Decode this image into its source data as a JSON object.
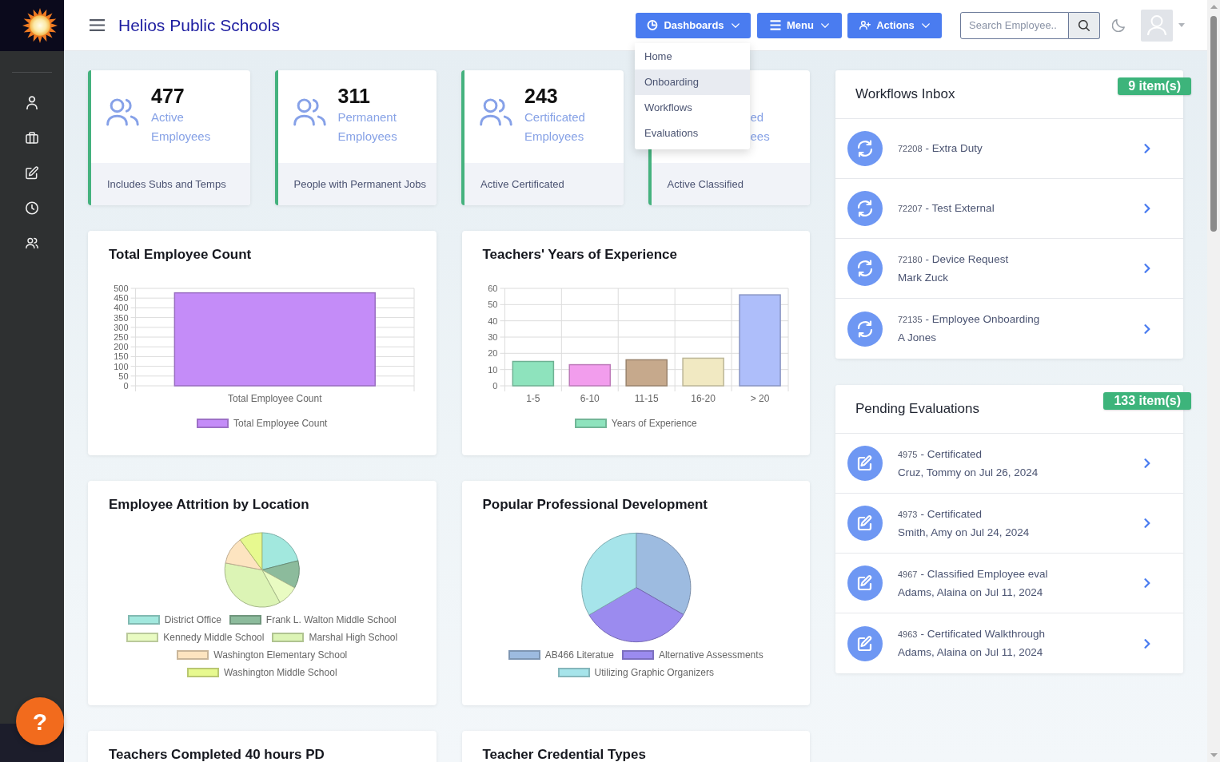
{
  "header": {
    "title": "Helios Public Schools",
    "buttons": [
      {
        "label": "Dashboards"
      },
      {
        "label": "Menu"
      },
      {
        "label": "Actions"
      }
    ],
    "search": {
      "placeholder": "Search Employee.."
    }
  },
  "dashboards_menu": {
    "items": [
      {
        "label": "Home",
        "selected": false
      },
      {
        "label": "Onboarding",
        "selected": true
      },
      {
        "label": "Workflows",
        "selected": false
      },
      {
        "label": "Evaluations",
        "selected": false
      }
    ]
  },
  "stat_cards": [
    {
      "value": "477",
      "label_lines": [
        "Active",
        "Employees"
      ],
      "footer": "Includes Subs and Temps"
    },
    {
      "value": "311",
      "label_lines": [
        "Permanent",
        "Employees"
      ],
      "footer": "People with Permanent Jobs"
    },
    {
      "value": "243",
      "label_lines": [
        "Certificated",
        "Employees"
      ],
      "footer": "Active Certificated"
    },
    {
      "label_lines": [
        "ed",
        "ees"
      ],
      "footer": "Active Classified"
    }
  ],
  "chart_cards": [
    {
      "title": "Total Employee Count",
      "chart_data": {
        "type": "bar",
        "categories": [
          "Total Employee Count"
        ],
        "series": [
          {
            "name": "Total Employee Count",
            "color": "#c48cf8",
            "values": [
              477
            ]
          }
        ],
        "ylim": [
          0,
          500
        ],
        "yticks": [
          0,
          50,
          100,
          150,
          200,
          250,
          300,
          350,
          400,
          450,
          500
        ],
        "grid": true,
        "legend": "bottom"
      }
    },
    {
      "title": "Teachers' Years of Experience",
      "chart_data": {
        "type": "bar",
        "categories": [
          "1-5",
          "6-10",
          "11-15",
          "16-20",
          "> 20"
        ],
        "series": [
          {
            "name": "Years of Experience",
            "color": "#8ee3bd",
            "colors": [
              "#8ee3bd",
              "#f29ded",
              "#c6a98c",
              "#f1e9c2",
              "#aebefa"
            ],
            "values": [
              15,
              13,
              16,
              17,
              56
            ]
          }
        ],
        "ylim": [
          0,
          60
        ],
        "yticks": [
          0,
          10,
          20,
          30,
          40,
          50,
          60
        ],
        "grid": true,
        "legend": "bottom"
      }
    },
    {
      "title": "Employee Attrition by Location",
      "chart_data": {
        "type": "pie",
        "categories": [
          "District Office",
          "Frank L. Walton Middle School",
          "Kennedy Middle School",
          "Marshal High School",
          "Washington Elementary School",
          "Washington Middle School"
        ],
        "values": [
          21,
          12,
          9,
          36,
          12,
          10
        ],
        "colors": [
          "#a2e8de",
          "#8cbb9c",
          "#e9fbc2",
          "#dcf4b5",
          "#fde4c0",
          "#e7f98f"
        ],
        "legend": "bottom"
      }
    },
    {
      "title": "Popular Professional Development",
      "chart_data": {
        "type": "pie",
        "categories": [
          "AB466 Literatue",
          "Alternative Assessments",
          "Utilizing Graphic Organizers"
        ],
        "values": [
          33.3,
          33.3,
          33.4
        ],
        "colors": [
          "#9dbbe0",
          "#9b8bef",
          "#a6e4ea"
        ],
        "legend": "bottom"
      }
    },
    {
      "title": "Teachers Completed 40 hours PD"
    },
    {
      "title": "Teacher Credential Types"
    }
  ],
  "workflows_inbox": {
    "title": "Workflows Inbox",
    "badge": "9 item(s)",
    "items": [
      {
        "number": "72208",
        "title": "- Extra Duty"
      },
      {
        "number": "72207",
        "title": "- Test External"
      },
      {
        "number": "72180",
        "title": "- Device Request",
        "subtitle": "Mark Zuck"
      },
      {
        "number": "72135",
        "title": "- Employee Onboarding",
        "subtitle": "A Jones"
      }
    ]
  },
  "pending_evaluations": {
    "title": "Pending Evaluations",
    "badge": "133 item(s)",
    "items": [
      {
        "number": "4975",
        "title": "- Certificated",
        "subtitle": "Cruz, Tommy on Jul 26, 2024"
      },
      {
        "number": "4973",
        "title": "- Certificated",
        "subtitle": "Smith, Amy on Jul 24, 2024"
      },
      {
        "number": "4967",
        "title": "- Classified Employee eval",
        "subtitle": "Adams, Alaina on Jul 11, 2024"
      },
      {
        "number": "4963",
        "title": "- Certificated Walkthrough",
        "subtitle": "Adams, Alaina on Jul 11, 2024"
      }
    ]
  },
  "help_button": {
    "label": "?"
  }
}
